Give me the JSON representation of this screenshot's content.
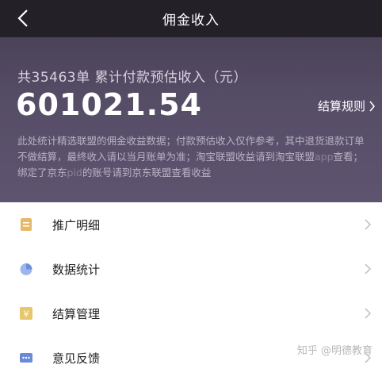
{
  "nav": {
    "title": "佣金收入"
  },
  "hero": {
    "summary": "共35463单 累计付款预估收入（元）",
    "amount": "601021.54",
    "settle_label": "结算规则",
    "note_parts": [
      "此处统计精选联盟的佣金收益数据；付款预估收入仅作参考，其中退货退款订单不做结算，最终收入请以当月账单为准；淘宝联盟收益请到淘宝联盟",
      "app",
      "查看；绑定了京东",
      "pid",
      "的账号请到京东联盟查看收益"
    ]
  },
  "menu": [
    {
      "label": "推广明细",
      "icon": "document-icon",
      "color": "#e8b86a"
    },
    {
      "label": "数据统计",
      "icon": "pie-chart-icon",
      "color": "#6d8fe0"
    },
    {
      "label": "结算管理",
      "icon": "yen-icon",
      "color": "#e6c76b"
    },
    {
      "label": "意见反馈",
      "icon": "chat-icon",
      "color": "#6a8bd8"
    }
  ],
  "watermark": "知乎 @明德教育"
}
